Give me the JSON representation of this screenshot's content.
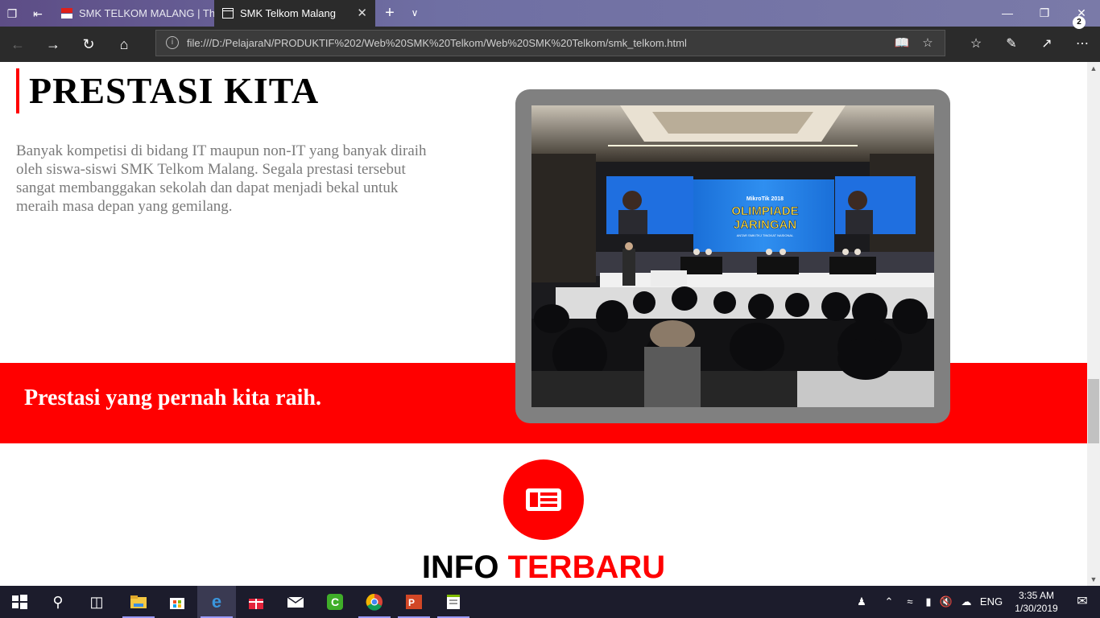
{
  "browser": {
    "tabs": [
      {
        "label": "SMK TELKOM MALANG | Th",
        "active": false
      },
      {
        "label": "SMK Telkom Malang",
        "active": true
      }
    ],
    "address": "file:///D:/PelajaraN/PRODUKTIF%202/Web%20SMK%20Telkom/Web%20SMK%20Telkom/smk_telkom.html",
    "icons": {
      "back": "back-arrow-icon",
      "forward": "forward-arrow-icon",
      "refresh": "refresh-icon",
      "home": "home-icon",
      "reading_view": "reading-view-icon",
      "favorite": "star-icon",
      "favorites_hub": "favorites-hub-icon",
      "notes": "pen-icon",
      "share": "share-icon",
      "more": "more-icon"
    },
    "accent": "#6f6fa3"
  },
  "page": {
    "heading": "PRESTASI KITA",
    "description": "Banyak kompetisi di bidang IT maupun non-IT yang banyak diraih oleh siswa-siswi SMK Telkom Malang. Segala prestasi tersebut sangat membanggakan sekolah dan dapat menjadi bekal untuk meraih masa depan yang gemilang.",
    "banner": "Prestasi yang pernah kita raih.",
    "photo": {
      "screen_logo_top": "MikroTik 2018",
      "screen_logo_main1": "OLIMPIADE",
      "screen_logo_main2": "JARINGAN",
      "screen_logo_sub": "ANTAR SMK/TKJ TINGKAT NASIONAL"
    },
    "info_title_1": "INFO",
    "info_title_2": "TERBARU",
    "info_icon": "newspaper-icon",
    "colors": {
      "red": "#ff0000",
      "frame": "#808080",
      "text_gray": "#7a7a7a"
    }
  },
  "taskbar": {
    "apps": [
      "start-icon",
      "search-icon",
      "task-view-icon",
      "file-explorer-icon",
      "store-icon",
      "edge-icon",
      "gift-icon",
      "mail-icon",
      "camtasia-icon",
      "chrome-icon",
      "powerpoint-icon",
      "notepad-icon"
    ],
    "tray_lang": "ENG",
    "time": "3:35 AM",
    "date": "1/30/2019",
    "notification_count": "2"
  }
}
